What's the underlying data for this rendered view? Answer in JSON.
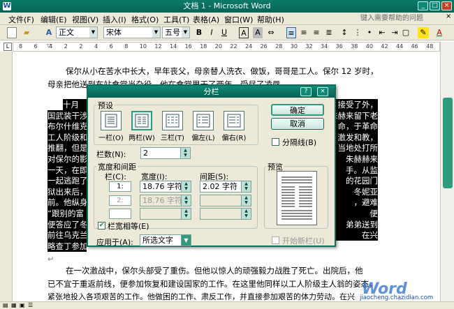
{
  "window": {
    "title": "文档 1 - Microsoft Word",
    "icon": "word-app-icon"
  },
  "menu": {
    "items": [
      "文件(F)",
      "编辑(E)",
      "视图(V)",
      "插入(I)",
      "格式(O)",
      "工具(T)",
      "表格(A)",
      "窗口(W)",
      "帮助(H)"
    ],
    "help_placeholder": "键入需要帮助的问题"
  },
  "toolbar": {
    "style": "正文",
    "font": "宋体",
    "size": "五号",
    "bold": "B",
    "italic": "I",
    "underline": "U",
    "border_a": "A",
    "char_a": "A",
    "font_color_a": "A"
  },
  "ruler": {
    "ticks": [
      "8",
      "6",
      "4",
      "2",
      "2",
      "4",
      "6",
      "8",
      "10",
      "12",
      "14",
      "16",
      "18",
      "20",
      "22",
      "24",
      "26",
      "28",
      "30",
      "32",
      "34",
      "36",
      "38",
      "40",
      "42",
      "44",
      "46",
      "48"
    ]
  },
  "document": {
    "para1_line1": "保尔从小在苦水中长大，早年丧父，母亲替人洗衣、做饭，哥哥是工人。保尔 12 岁时，",
    "para1_line2": "母亲把他送到车站食堂当杂役，他在食堂里干了两年，受尽了凌辱。",
    "left_sel": [
      "十月",
      "国武装干涉",
      "布尔什维克",
      "工人阶级和",
      "推翻，但是",
      "对保尔的影",
      "一天，在即",
      "一起逃跑了",
      "狱出来后，",
      "前。他纵身",
      "“跟别的富",
      "便答应了冬",
      "前往乌克兰",
      "略查丁参加"
    ],
    "right_sel": [
      "，接受了外",
      "朱赫来留下老",
      "命，于革命、",
      "，激发和教",
      "当地处打所。",
      "朱赫赫来",
      "手。从监",
      "的花园门",
      "冬妮亚",
      "避难，",
      "便",
      "弟弟送到",
      "在兴"
    ],
    "para_mark": "↵",
    "para2_line1": "在一次激战中，保尔头部受了重伤。但他以惊人的顽强毅力战胜了死亡。出院后，他",
    "para2_line2": "已不宜于重返前线，便参加恢复和建设国家的工作。在这里他同样以工人阶级主人翁的姿态，",
    "para2_line3": "紧张地投入各项艰苦的工作。他做困的工作、肃反工作，并直接参加艰苦的体力劳动。在兴",
    "watermark": "jiaocheng.chazidian.com"
  },
  "dialog": {
    "title": "分栏",
    "preset_label": "预设",
    "presets": [
      "一栏(O)",
      "两栏(W)",
      "三栏(T)",
      "偏左(L)",
      "偏右(R)"
    ],
    "ok": "确定",
    "cancel": "取消",
    "line_between": "分隔线(B)",
    "num_cols_label": "栏数(N):",
    "num_cols": "2",
    "width_spacing_label": "宽度和间距",
    "col_header": "栏(C):",
    "width_header": "宽度(I):",
    "spacing_header": "间距(S):",
    "rows": [
      {
        "col": "1:",
        "width": "18.76 字符",
        "spacing": "2.02 字符"
      },
      {
        "col": "2:",
        "width": "18.76 字符",
        "spacing": ""
      },
      {
        "col": "",
        "width": "",
        "spacing": ""
      }
    ],
    "equal_width": "栏宽相等(E)",
    "equal_checked": true,
    "apply_label": "应用于(A):",
    "apply_value": "所选文字",
    "preview_label": "预览",
    "new_column": "开始新栏(U)"
  },
  "colors": {
    "title_bar": "#076050",
    "selection": "#000000",
    "accent": "#2f9a7e"
  }
}
